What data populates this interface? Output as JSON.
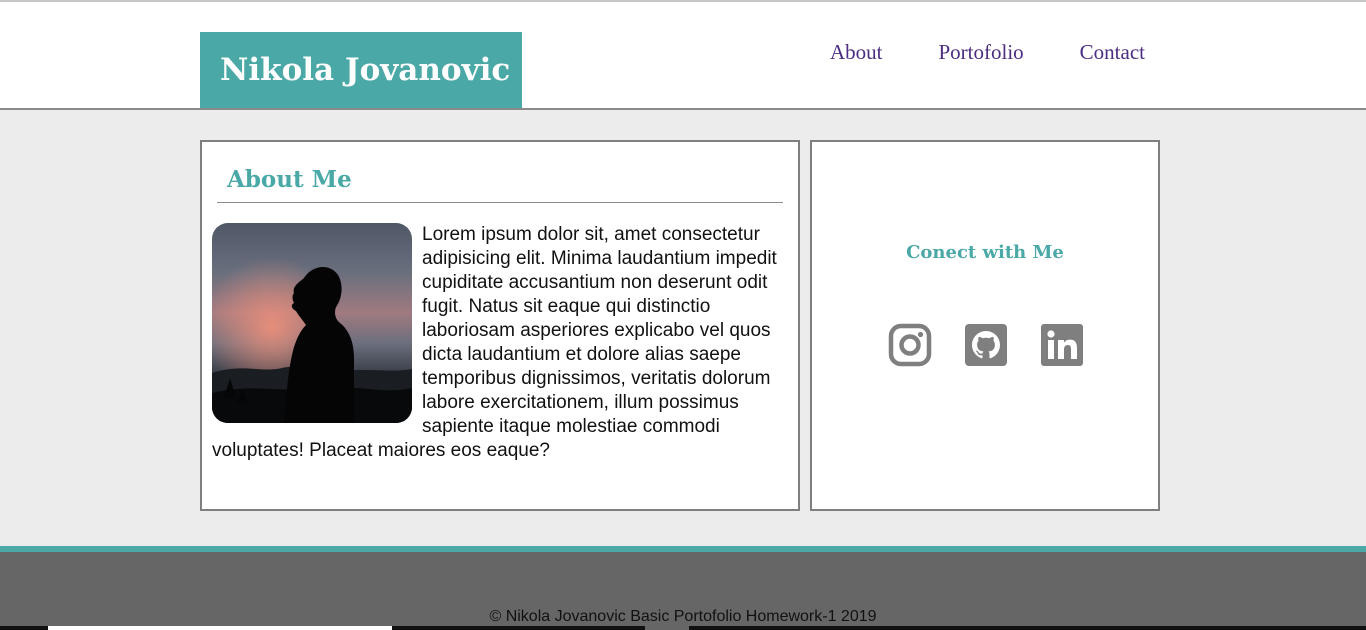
{
  "header": {
    "brand": "Nikola Jovanovic",
    "nav": [
      "About",
      "Portofolio",
      "Contact"
    ]
  },
  "about": {
    "title": "About Me",
    "photo": "profile-photo-silhouette",
    "text": "Lorem ipsum dolor sit, amet consectetur adipisicing elit. Minima laudantium impedit cupiditate accusantium non deserunt odit fugit. Natus sit eaque qui distinctio laboriosam asperiores explicabo vel quos dicta laudantium et dolore alias saepe temporibus dignissimos, veritatis dolorum labore exercitationem, illum possimus sapiente itaque molestiae commodi voluptates! Placeat maiores eos eaque?"
  },
  "connect": {
    "title": "Conect with Me",
    "icons": [
      "instagram-icon",
      "github-icon",
      "linkedin-icon"
    ]
  },
  "footer": {
    "copyright": "© Nikola Jovanovic Basic Portofolio Homework-1 2019"
  },
  "colors": {
    "accent": "#4aa9a6",
    "nav_link": "#4b2d82",
    "footer_bg": "#666666",
    "page_bg": "#ececec",
    "icon_gray": "#7f7f7f"
  }
}
